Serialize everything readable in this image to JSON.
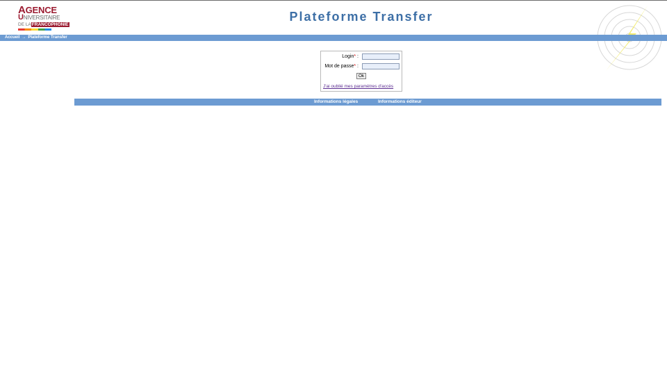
{
  "header": {
    "title": "Plateforme Transfer",
    "logo": {
      "line1_cap": "A",
      "line1_rest": "GENCE",
      "line2_cap": "U",
      "line2_rest": "NIVERSITAIRE",
      "line3_prefix": "DE LA",
      "line3_word": "FRANCOPHONIE"
    }
  },
  "breadcrumb": {
    "items": [
      "Accueil",
      "Plateforme Transfer"
    ],
    "separator": "→"
  },
  "login_form": {
    "login_label": "Login",
    "password_label": "Mot de passe",
    "required_mark": "*",
    "colon": " :",
    "login_value": "",
    "password_value": "",
    "submit_label": "Ok",
    "forgot_link": "J'ai oublié mes paramètres d'accès"
  },
  "footer": {
    "links": [
      "Informations légales",
      "Informations éditeur"
    ]
  },
  "colors": {
    "bar": "#6c9bd2",
    "title": "#3d6fa6",
    "logo_red": "#9b1b30"
  }
}
